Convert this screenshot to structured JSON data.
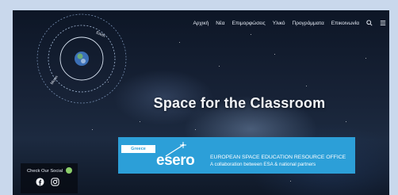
{
  "nav": {
    "items": [
      "Αρχική",
      "Νέα",
      "Επιμορφώσεις",
      "Υλικό",
      "Προγράμματα",
      "Επικοινωνία"
    ],
    "icons": [
      "search-icon",
      "menu-icon"
    ]
  },
  "logo": {
    "label_earth": "Earth",
    "label_moon": "Moon"
  },
  "hero": {
    "title": "Space for the Classroom"
  },
  "esero": {
    "tag": "Greece",
    "wordmark": "esero",
    "line1": "EUROPEAN SPACE EDUCATION RESOURCE OFFICE",
    "line2": "A collaboration between ESA & national partners",
    "color": "#2c9fd8"
  },
  "social": {
    "label": "Check Our Social",
    "icons": [
      "facebook-icon",
      "instagram-icon"
    ]
  }
}
